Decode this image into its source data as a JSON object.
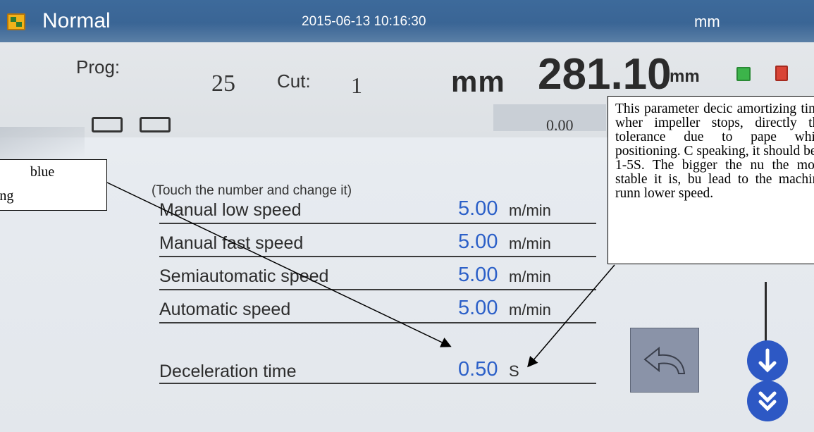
{
  "titlebar": {
    "mode": "Normal",
    "datetime": "2015-06-13  10:16:30",
    "unit": "mm"
  },
  "status": {
    "prog_label": "Prog:",
    "prog_value": "25",
    "cut_label": "Cut:",
    "cut_value": "1",
    "unit_large": "mm",
    "position": "281.10",
    "position_unit": "mm",
    "offset_value": "0.00"
  },
  "hint": "(Touch the number and change it)",
  "parameters": [
    {
      "name": "Manual low speed",
      "value": "5.00",
      "unit": "m/min"
    },
    {
      "name": "Manual fast speed",
      "value": "5.00",
      "unit": "m/min"
    },
    {
      "name": "Semiautomatic speed",
      "value": "5.00",
      "unit": "m/min"
    },
    {
      "name": "Automatic speed",
      "value": "5.00",
      "unit": "m/min"
    },
    {
      "name": "Deceleration time",
      "value": "0.50",
      "unit": "S"
    }
  ],
  "callouts": {
    "left_line1": "ch blue",
    "left_line2": "tal modifying",
    "right_text": "This parameter decic amortizing time wher impeller stops, directly the tolerance due to pape while positioning. C speaking, it should be s 1-5S. The bigger the nu the more stable it is, bu lead to the machine runn lower speed."
  },
  "icons": {
    "app": "app-grid-icon",
    "back": "back-arrow-icon",
    "down": "chevron-down-icon",
    "double_down": "double-chevron-down-icon",
    "save": "save-icon",
    "delete": "trash-icon"
  },
  "colors": {
    "titlebar": "#3d6a9b",
    "value_blue": "#2c60c8",
    "button_blue": "#2d58c4",
    "back_button": "#8a93a8"
  }
}
